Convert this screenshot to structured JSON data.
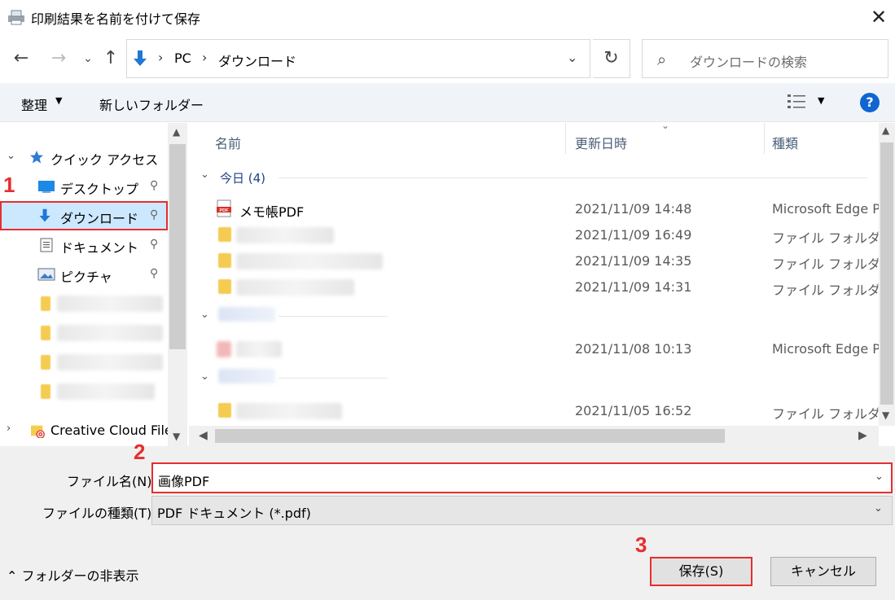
{
  "window": {
    "title": "印刷結果を名前を付けて保存",
    "close": "✕"
  },
  "nav": {
    "back": "←",
    "forward": "→",
    "recent": "⌄",
    "up": "↑",
    "address": {
      "sep": "›",
      "crumbs": [
        "PC",
        "ダウンロード"
      ],
      "dropdown": "⌄"
    },
    "refresh": "↻",
    "search": {
      "placeholder": "ダウンロードの検索",
      "icon": "⌕"
    }
  },
  "toolbar": {
    "organize": "整理",
    "organize_arrow": "▼",
    "new_folder": "新しいフォルダー",
    "view_arrow": "▼",
    "help": "?"
  },
  "sidebar": {
    "quick_access": "クイック アクセス",
    "items": [
      {
        "label": "デスクトップ",
        "pin": "📌"
      },
      {
        "label": "ダウンロード",
        "pin": "📌"
      },
      {
        "label": "ドキュメント",
        "pin": "📌"
      },
      {
        "label": "ピクチャ",
        "pin": "📌"
      }
    ],
    "creative_cloud": "Creative Cloud File",
    "expand": "›",
    "collapse": "⌄"
  },
  "file_list": {
    "columns": {
      "name": "名前",
      "date": "更新日時",
      "type": "種類"
    },
    "sort_caret": "⌄",
    "groups": [
      {
        "label": "今日 (4)",
        "chevron": "⌄"
      }
    ],
    "rows": [
      {
        "name": "メモ帳PDF",
        "date": "2021/11/09 14:48",
        "type": "Microsoft Edge P"
      },
      {
        "name": "",
        "date": "2021/11/09 16:49",
        "type": "ファイル フォルダー"
      },
      {
        "name": "",
        "date": "2021/11/09 14:35",
        "type": "ファイル フォルダー"
      },
      {
        "name": "",
        "date": "2021/11/09 14:31",
        "type": "ファイル フォルダー"
      },
      {
        "name": "",
        "date": "2021/11/08 10:13",
        "type": "Microsoft Edge P"
      },
      {
        "name": "",
        "date": "2021/11/05 16:52",
        "type": "ファイル フォルダー"
      }
    ]
  },
  "form": {
    "filename_label": "ファイル名(N):",
    "filename_value": "画像PDF",
    "filetype_label": "ファイルの種類(T):",
    "filetype_value": "PDF ドキュメント (*.pdf)",
    "dropdown": "⌄"
  },
  "footer": {
    "hide_folders": "フォルダーの非表示",
    "hide_arrow": "⌃",
    "save": "保存(S)",
    "cancel": "キャンセル"
  },
  "annotations": [
    "1",
    "2",
    "3"
  ],
  "colors": {
    "highlight": "#e62e2e",
    "selection": "#cce8ff",
    "help_blue": "#0f66d0",
    "folder": "#f5cc52"
  }
}
